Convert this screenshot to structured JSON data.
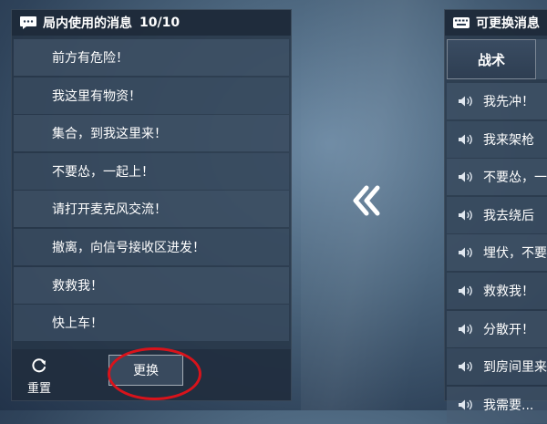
{
  "left_panel": {
    "title": "局内使用的消息",
    "count": "10/10",
    "messages": [
      "前方有危险！",
      "我这里有物资！",
      "集合，到我这里来！",
      "不要怂，一起上！",
      "请打开麦克风交流！",
      "撤离，向信号接收区进发！",
      "救救我！",
      "快上车！"
    ],
    "reset_label": "重置",
    "swap_label": "更换"
  },
  "right_panel": {
    "title": "可更换消息",
    "tab_label": "战术",
    "messages": [
      "我先冲！",
      "我来架枪",
      "不要怂，一",
      "我去绕后",
      "埋伏，不要",
      "救救我！",
      "分散开！",
      "到房间里来",
      "我需要..."
    ]
  },
  "colors": {
    "highlight_circle": "#d8131b",
    "panel_bg": "#263446"
  },
  "icons": {
    "left_header": "chat-bubble-icon",
    "right_header": "keyboard-icon",
    "reset": "refresh-icon",
    "transfer": "double-chevron-left-icon",
    "message_item": "speaker-icon"
  }
}
